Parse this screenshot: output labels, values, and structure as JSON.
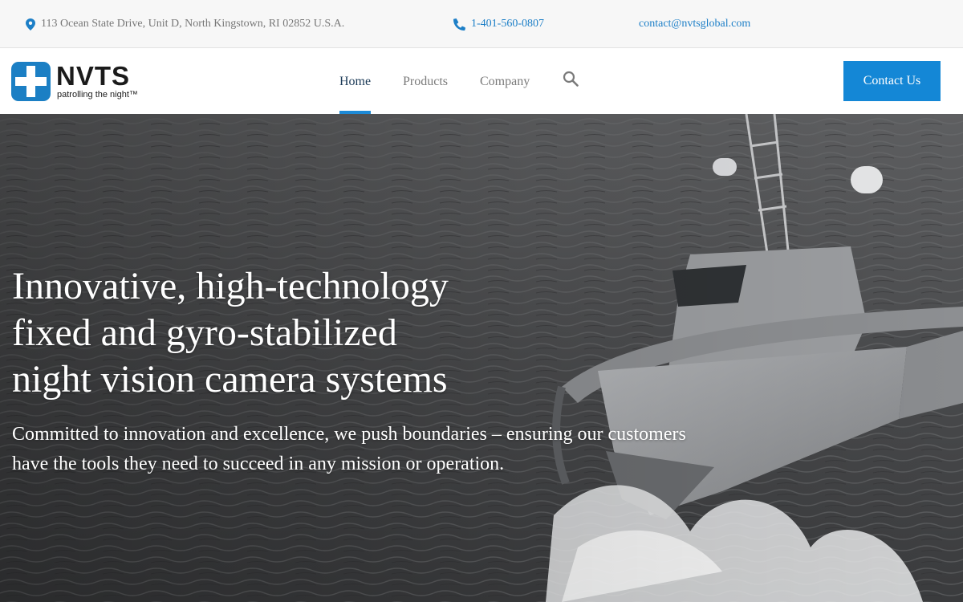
{
  "topbar": {
    "address": "113 Ocean State Drive, Unit D, North Kingstown, RI 02852 U.S.A.",
    "phone": "1-401-560-0807",
    "email": "contact@nvtsglobal.com",
    "icons": {
      "address": "map-pin-icon",
      "phone": "phone-icon"
    }
  },
  "header": {
    "logo": {
      "wordmark": "NVTS",
      "tagline": "patrolling the night™"
    },
    "nav": [
      {
        "label": "Home",
        "active": true
      },
      {
        "label": "Products",
        "active": false
      },
      {
        "label": "Company",
        "active": false
      }
    ],
    "search_icon": "search-icon",
    "cta_label": "Contact Us"
  },
  "hero": {
    "title_lines": [
      "Innovative, high-technology",
      "fixed and gyro-stabilized",
      "night vision camera systems"
    ],
    "subtitle_lines": [
      "Committed to innovation and excellence, we push boundaries – ensuring our customers",
      "have the tools they need to succeed in any mission or operation."
    ]
  },
  "colors": {
    "accent": "#1487d6",
    "link": "#1d7fc7",
    "logo_blue": "#1b7fc4",
    "topbar_bg": "#f7f7f7"
  }
}
